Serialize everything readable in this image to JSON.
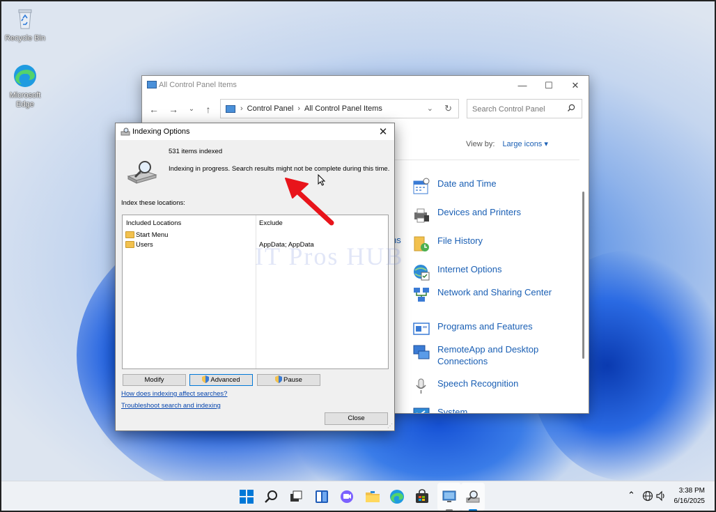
{
  "desktop": {
    "icons": [
      {
        "label": "Recycle Bin",
        "icon": "recycle-bin-icon"
      },
      {
        "label": "Microsoft Edge",
        "icon": "edge-icon"
      }
    ]
  },
  "control_panel": {
    "title": "All Control Panel Items",
    "breadcrumb": [
      "Control Panel",
      "All Control Panel Items"
    ],
    "search_placeholder": "Search Control Panel",
    "view_by_label": "View by:",
    "view_by_value": "Large icons",
    "left_fragments": [
      "r",
      "ns"
    ],
    "items": [
      {
        "label": "Date and Time",
        "icon": "date-time-icon"
      },
      {
        "label": "Devices and Printers",
        "icon": "printer-icon"
      },
      {
        "label": "File History",
        "icon": "file-history-icon"
      },
      {
        "label": "Internet Options",
        "icon": "internet-options-icon"
      },
      {
        "label": "Network and Sharing Center",
        "icon": "network-icon"
      },
      {
        "label": "Programs and Features",
        "icon": "programs-icon"
      },
      {
        "label": "RemoteApp and Desktop Connections",
        "icon": "remoteapp-icon"
      },
      {
        "label": "Speech Recognition",
        "icon": "microphone-icon"
      },
      {
        "label": "System",
        "icon": "system-icon"
      }
    ]
  },
  "watermark": "IT Pros HUB",
  "indexing": {
    "title": "Indexing Options",
    "count": "531 items indexed",
    "status": "Indexing in progress. Search results might not be complete during this time.",
    "locations_label": "Index these locations:",
    "columns": [
      "Included Locations",
      "Exclude"
    ],
    "rows": [
      {
        "name": "Start Menu",
        "exclude": ""
      },
      {
        "name": "Users",
        "exclude": "AppData; AppData"
      }
    ],
    "buttons": {
      "modify": "Modify",
      "advanced": "Advanced",
      "pause": "Pause",
      "close": "Close"
    },
    "links": [
      "How does indexing affect searches?",
      "Troubleshoot search and indexing"
    ]
  },
  "taskbar": {
    "apps": [
      "start-icon",
      "search-icon",
      "task-view-icon",
      "widgets-icon",
      "chat-icon",
      "file-explorer-icon",
      "edge-icon",
      "store-icon",
      "control-panel-icon",
      "indexing-options-icon"
    ],
    "time": "3:38 PM",
    "date": "6/16/2025"
  },
  "colors": {
    "accent": "#0078d7",
    "link": "#1a5fb4",
    "arrow": "#e8141b"
  }
}
